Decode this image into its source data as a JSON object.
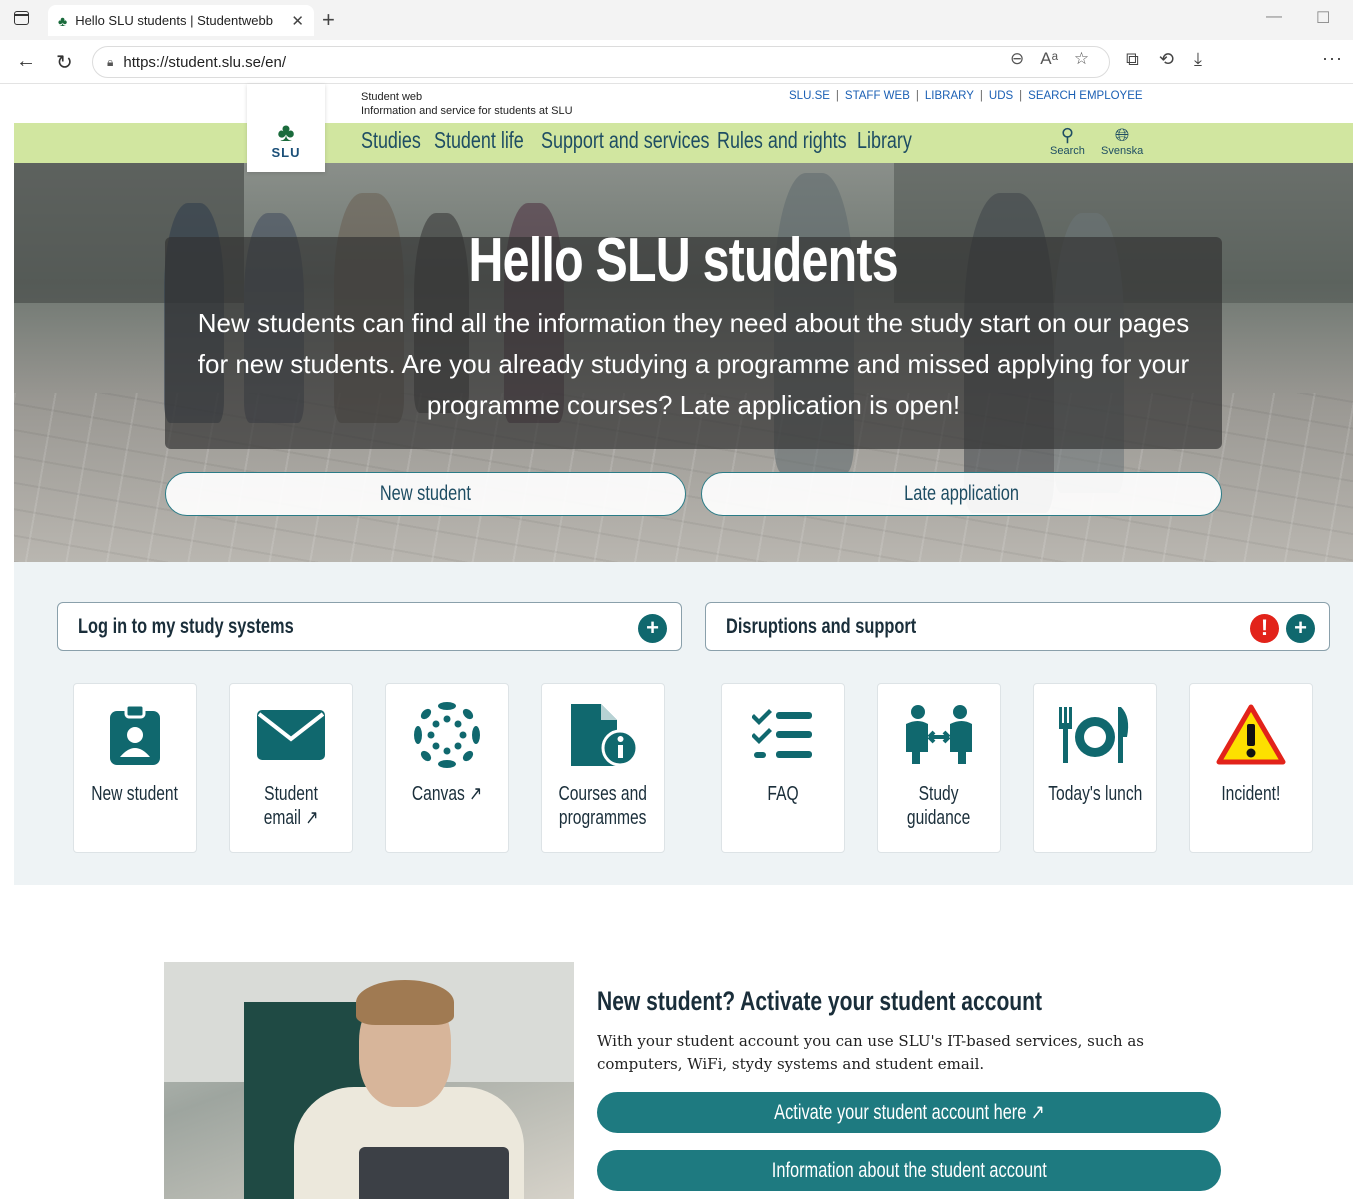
{
  "browser": {
    "tab_title": "Hello SLU students | Studentwebb",
    "url": "https://student.slu.se/en/"
  },
  "site": {
    "logo_text": "SLU",
    "tagline_1": "Student web",
    "tagline_2": "Information and service for students at SLU",
    "toplinks": [
      "SLU.SE",
      "STAFF WEB",
      "LIBRARY",
      "UDS",
      "SEARCH EMPLOYEE"
    ],
    "nav": [
      "Studies",
      "Student life",
      "Support and services",
      "Rules and rights",
      "Library"
    ],
    "search_label": "Search",
    "lang_label": "Svenska"
  },
  "hero": {
    "title": "Hello SLU students",
    "text": "New students can find all the information they need about the study start on our pages for new students. Are you already studying a programme and missed applying for your programme courses? Late application is open!",
    "btn_new": "New student",
    "btn_late": "Late application"
  },
  "quick": {
    "login_label": "Log in to my study systems",
    "disrupt_label": "Disruptions and support",
    "cards": [
      {
        "label": "New student",
        "icon": "badge-icon"
      },
      {
        "label": "Student\nemail ↗",
        "icon": "envelope-icon"
      },
      {
        "label": "Canvas ↗",
        "icon": "canvas-icon"
      },
      {
        "label": "Courses and\nprogrammes",
        "icon": "document-info-icon"
      },
      {
        "label": "FAQ",
        "icon": "checklist-icon"
      },
      {
        "label": "Study\nguidance",
        "icon": "guidance-icon"
      },
      {
        "label": "Today's lunch",
        "icon": "lunch-icon"
      },
      {
        "label": "Incident!",
        "icon": "warning-icon"
      }
    ]
  },
  "account": {
    "heading": "New student? Activate your student account",
    "text": "With your student account you can use SLU's IT-based services, such as computers, WiFi, stydy systems and student email.",
    "btn_activate": "Activate your student account here ↗",
    "btn_info": "Information about the student account"
  },
  "colors": {
    "teal": "#1e7a80",
    "green_bar": "#d1e6a0",
    "dark_teal": "#10686e",
    "alert_red": "#e2231a"
  }
}
